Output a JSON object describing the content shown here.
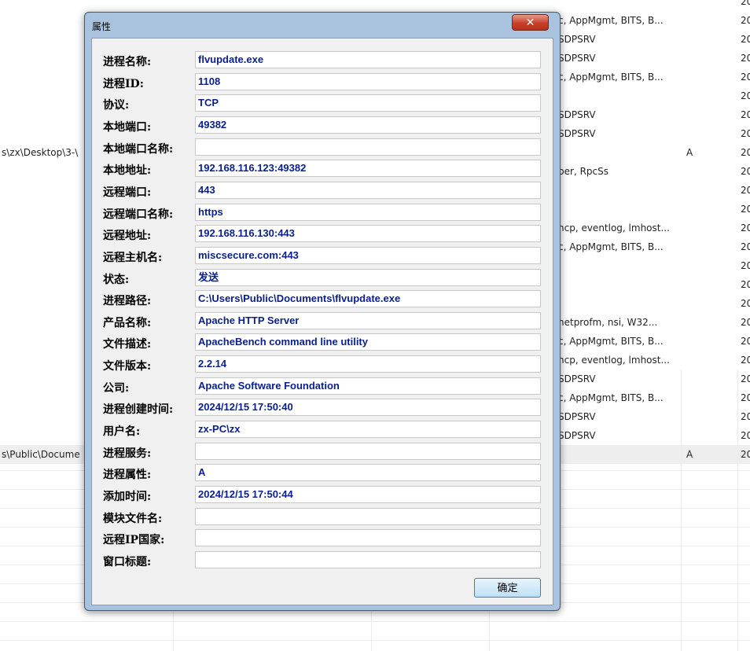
{
  "background": {
    "rows": [
      {
        "c1": "",
        "c2": "",
        "c3": "",
        "c4": "20"
      },
      {
        "c1": "",
        "c2": "c, AppMgmt, BITS, B...",
        "c3": "",
        "c4": "20"
      },
      {
        "c1": "",
        "c2": "SDPSRV",
        "c3": "",
        "c4": "20"
      },
      {
        "c1": "",
        "c2": "SDPSRV",
        "c3": "",
        "c4": "20"
      },
      {
        "c1": "",
        "c2": "c, AppMgmt, BITS, B...",
        "c3": "",
        "c4": "20"
      },
      {
        "c1": "",
        "c2": "",
        "c3": "",
        "c4": "20"
      },
      {
        "c1": "",
        "c2": "SDPSRV",
        "c3": "",
        "c4": "20"
      },
      {
        "c1": "",
        "c2": "SDPSRV",
        "c3": "",
        "c4": "20"
      },
      {
        "c1": "s\\zx\\Desktop\\3-\\",
        "c2": "",
        "c3": "A",
        "c4": "20"
      },
      {
        "c1": "",
        "c2": "per, RpcSs",
        "c3": "",
        "c4": "20"
      },
      {
        "c1": "",
        "c2": "",
        "c3": "",
        "c4": "20"
      },
      {
        "c1": "",
        "c2": "",
        "c3": "",
        "c4": "20"
      },
      {
        "c1": "",
        "c2": "hcp, eventlog, lmhost...",
        "c3": "",
        "c4": "20"
      },
      {
        "c1": "",
        "c2": "c, AppMgmt, BITS, B...",
        "c3": "",
        "c4": "20"
      },
      {
        "c1": "",
        "c2": "",
        "c3": "",
        "c4": "20"
      },
      {
        "c1": "",
        "c2": "",
        "c3": "",
        "c4": "20"
      },
      {
        "c1": "",
        "c2": "",
        "c3": "",
        "c4": "20"
      },
      {
        "c1": "",
        "c2": "netprofm, nsi, W32...",
        "c3": "",
        "c4": "20"
      },
      {
        "c1": "",
        "c2": "c, AppMgmt, BITS, B...",
        "c3": "",
        "c4": "20"
      },
      {
        "c1": "",
        "c2": "hcp, eventlog, lmhost...",
        "c3": "",
        "c4": "20"
      },
      {
        "c1": "",
        "c2": "SDPSRV",
        "c3": "",
        "c4": "20"
      },
      {
        "c1": "",
        "c2": "c, AppMgmt, BITS, B...",
        "c3": "",
        "c4": "20"
      },
      {
        "c1": "",
        "c2": "SDPSRV",
        "c3": "",
        "c4": "20"
      },
      {
        "c1": "",
        "c2": "SDPSRV",
        "c3": "",
        "c4": "20"
      },
      {
        "c1": "s\\Public\\Docume",
        "c2": "",
        "c3": "A",
        "c4": "20"
      }
    ]
  },
  "dialog": {
    "title": "属性",
    "close_glyph": "✕",
    "fields": [
      {
        "label": "进程名称:",
        "value": "flvupdate.exe"
      },
      {
        "label": "进程ID:",
        "value": "1108"
      },
      {
        "label": "协议:",
        "value": "TCP"
      },
      {
        "label": "本地端口:",
        "value": "49382"
      },
      {
        "label": "本地端口名称:",
        "value": ""
      },
      {
        "label": "本地地址:",
        "value": "192.168.116.123:49382"
      },
      {
        "label": "远程端口:",
        "value": "443"
      },
      {
        "label": "远程端口名称:",
        "value": "https"
      },
      {
        "label": "远程地址:",
        "value": "192.168.116.130:443"
      },
      {
        "label": "远程主机名:",
        "value": "miscsecure.com:443"
      },
      {
        "label": "状态:",
        "value": "发送"
      },
      {
        "label": "进程路径:",
        "value": "C:\\Users\\Public\\Documents\\flvupdate.exe"
      },
      {
        "label": "产品名称:",
        "value": "Apache HTTP Server"
      },
      {
        "label": "文件描述:",
        "value": "ApacheBench command line utility"
      },
      {
        "label": "文件版本:",
        "value": "2.2.14"
      },
      {
        "label": "公司:",
        "value": "Apache Software Foundation"
      },
      {
        "label": "进程创建时间:",
        "value": "2024/12/15 17:50:40"
      },
      {
        "label": "用户名:",
        "value": "zx-PC\\zx"
      },
      {
        "label": "进程服务:",
        "value": ""
      },
      {
        "label": "进程属性:",
        "value": "A"
      },
      {
        "label": "添加时间:",
        "value": "2024/12/15 17:50:44"
      },
      {
        "label": "模块文件名:",
        "value": ""
      },
      {
        "label": "远程IP国家:",
        "value": ""
      },
      {
        "label": "窗口标题:",
        "value": ""
      }
    ],
    "ok_label": "确定"
  }
}
